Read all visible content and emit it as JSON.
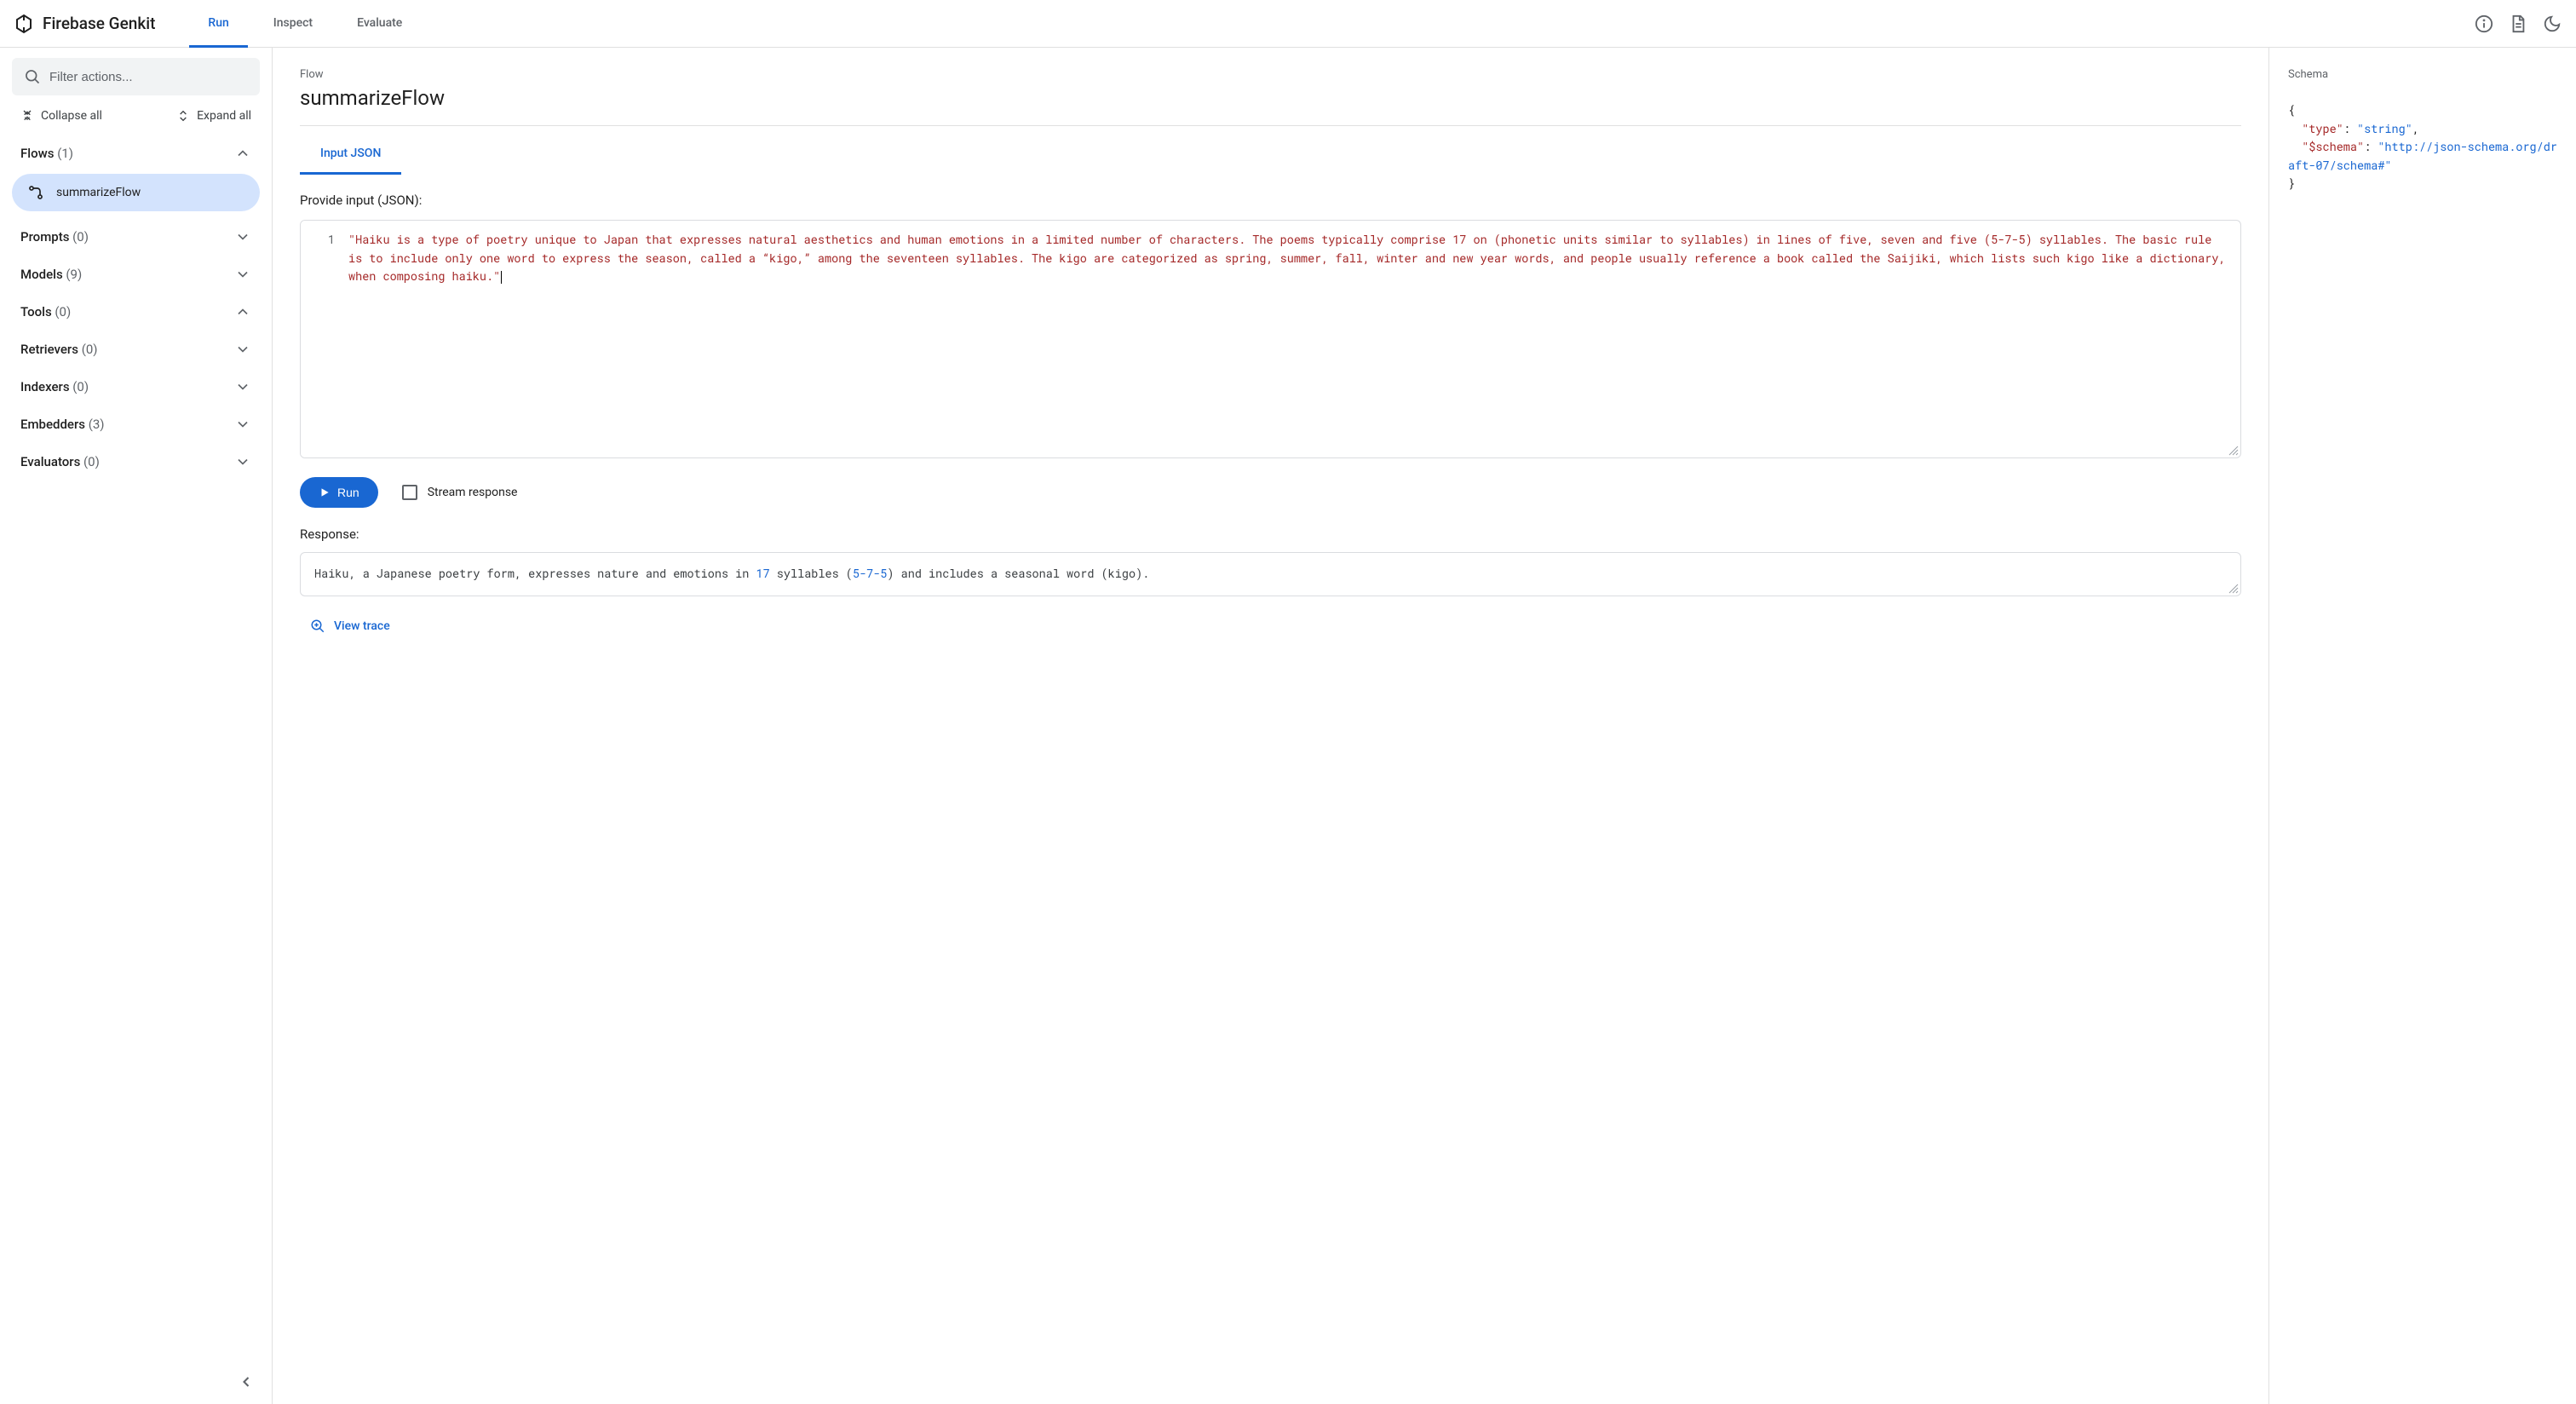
{
  "header": {
    "brand": "Firebase Genkit",
    "tabs": [
      {
        "label": "Run",
        "active": true
      },
      {
        "label": "Inspect",
        "active": false
      },
      {
        "label": "Evaluate",
        "active": false
      }
    ]
  },
  "sidebar": {
    "search_placeholder": "Filter actions...",
    "collapse_all": "Collapse all",
    "expand_all": "Expand all",
    "sections": [
      {
        "name": "Flows",
        "count": "(1)",
        "expanded": true,
        "items": [
          {
            "label": "summarizeFlow",
            "selected": true
          }
        ]
      },
      {
        "name": "Prompts",
        "count": "(0)",
        "expanded": false
      },
      {
        "name": "Models",
        "count": "(9)",
        "expanded": false
      },
      {
        "name": "Tools",
        "count": "(0)",
        "expanded": true
      },
      {
        "name": "Retrievers",
        "count": "(0)",
        "expanded": false
      },
      {
        "name": "Indexers",
        "count": "(0)",
        "expanded": false
      },
      {
        "name": "Embedders",
        "count": "(3)",
        "expanded": false
      },
      {
        "name": "Evaluators",
        "count": "(0)",
        "expanded": false
      }
    ]
  },
  "main": {
    "breadcrumb": "Flow",
    "title": "summarizeFlow",
    "input_tab": "Input JSON",
    "input_label": "Provide input (JSON):",
    "code_line_number": "1",
    "code_text": "\"Haiku is a type of poetry unique to Japan that expresses natural aesthetics and human emotions in a limited number of characters. The poems typically comprise 17 on (phonetic units similar to syllables) in lines of five, seven and five (5-7-5) syllables. The basic rule is to include only one word to express the season, called a “kigo,” among the seventeen syllables. The kigo are categorized as spring, summer, fall, winter and new year words, and people usually reference a book called the Saijiki, which lists such kigo like a dictionary, when composing haiku.\"",
    "run_label": "Run",
    "stream_label": "Stream response",
    "response_label": "Response:",
    "response_pre": "Haiku, a Japanese poetry form, expresses nature and emotions in ",
    "response_num1": "17",
    "response_mid": " syllables (",
    "response_num2": "5-7-5",
    "response_post": ") and includes a seasonal word (kigo).",
    "view_trace": "View trace"
  },
  "schema": {
    "title": "Schema",
    "key_type": "\"type\"",
    "val_type": "\"string\"",
    "key_schema": "\"$schema\"",
    "val_schema": "\"http://json-schema.org/draft-07/schema#\""
  }
}
